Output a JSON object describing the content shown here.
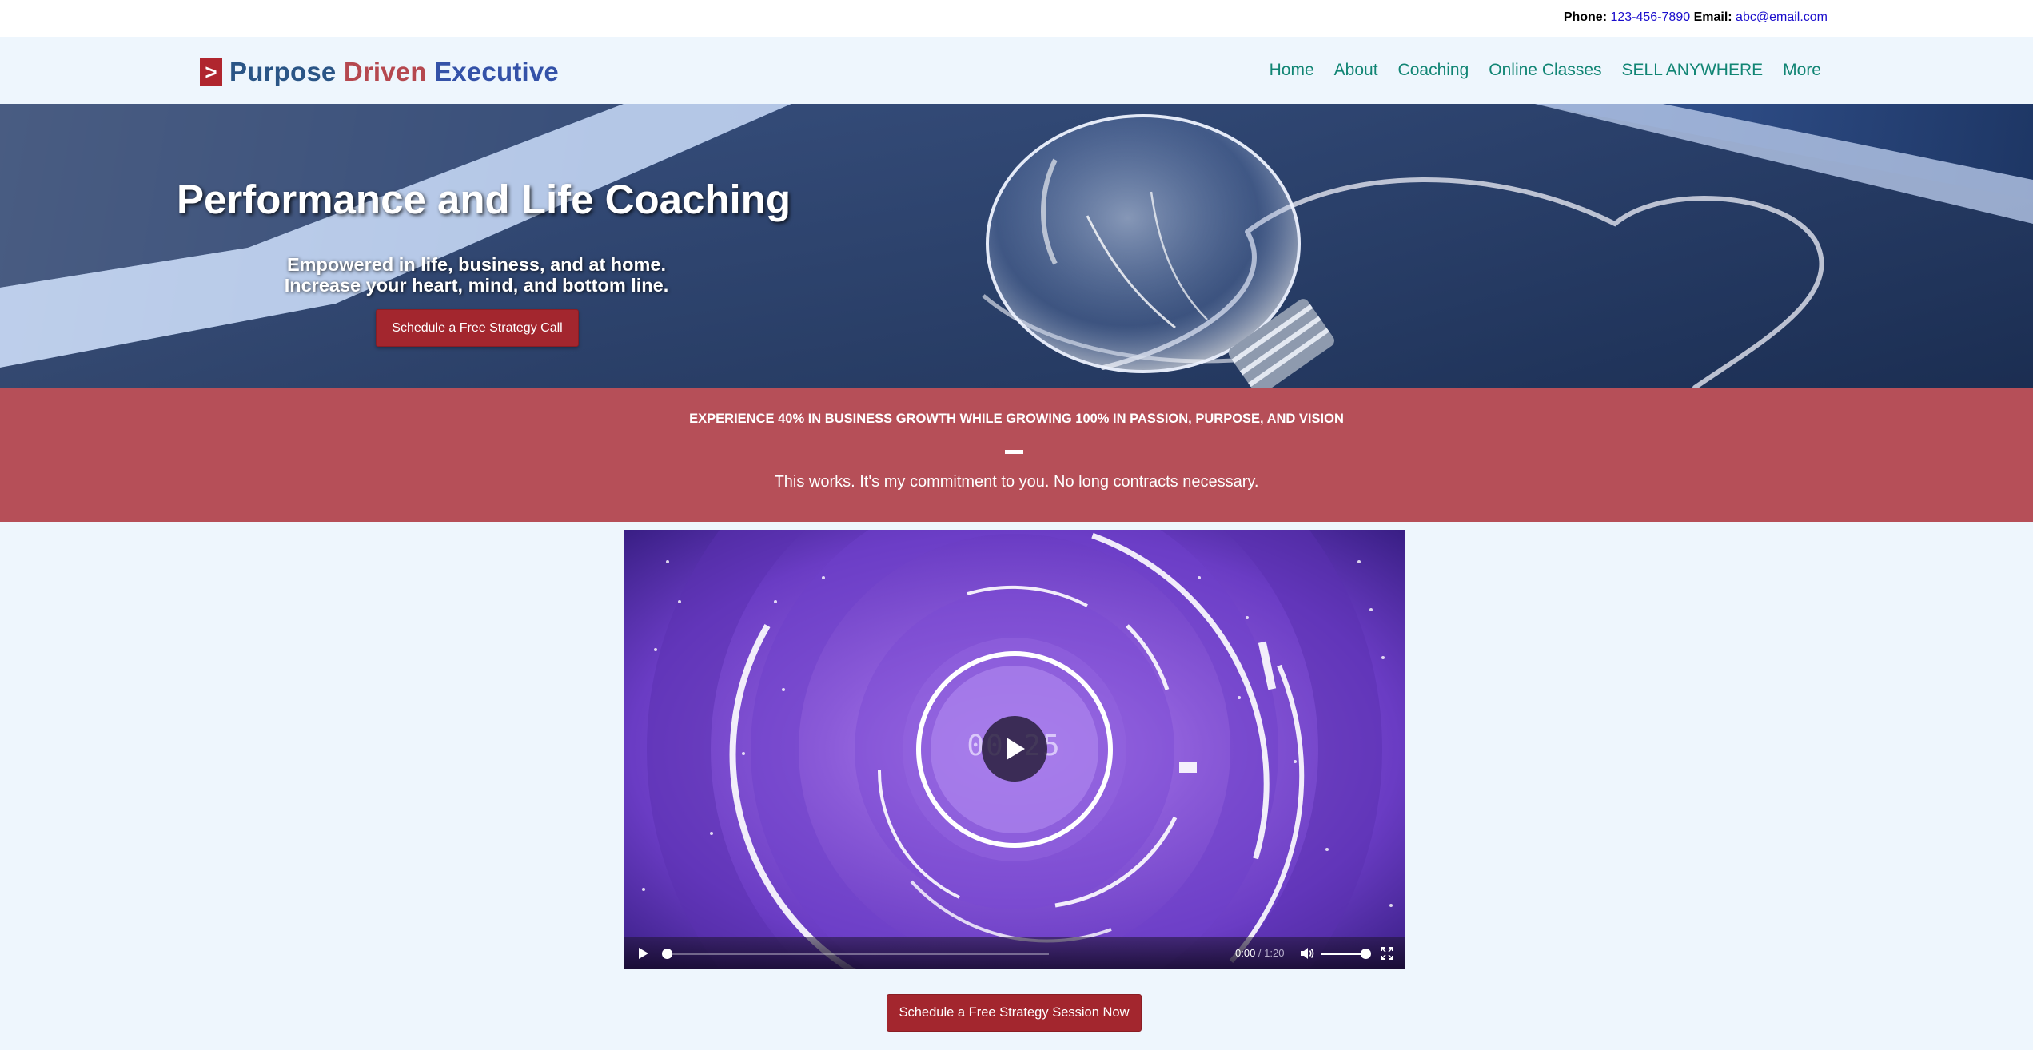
{
  "contact": {
    "phone_label": "Phone:",
    "phone": "123-456-7890",
    "email_label": "Email:",
    "email": "abc@email.com"
  },
  "logo": {
    "mark": ">",
    "word1": "Purpose",
    "word2": "Driven",
    "word3": "Executive"
  },
  "nav": {
    "items": [
      "Home",
      "About",
      "Coaching",
      "Online Classes",
      "SELL ANYWHERE",
      "More"
    ]
  },
  "hero": {
    "title": "Performance and Life Coaching",
    "subtitle_line1": "Empowered in life, business, and at home.",
    "subtitle_line2": "Increase your heart, mind, and bottom line.",
    "button": "Schedule a Free Strategy Call"
  },
  "band": {
    "headline": "EXPERIENCE 40% IN BUSINESS GROWTH WHILE GROWING 100% IN PASSION, PURPOSE, AND VISION",
    "text": "This works. It's my commitment to you. No long contracts necessary."
  },
  "video": {
    "countdown": "00:25",
    "current_time": "0:00",
    "separator": " / ",
    "duration": "1:20",
    "progress": 0,
    "volume": 0.85,
    "icons": [
      "play-icon",
      "volume-icon",
      "fullscreen-icon"
    ]
  },
  "cta": {
    "button": "Schedule a Free Strategy Session Now"
  },
  "colors": {
    "brand_red": "#a3262e",
    "band_red": "#b64f58",
    "nav_teal": "#118574",
    "logo_blue": "#2a5586",
    "page_bg": "#eef6fd"
  }
}
